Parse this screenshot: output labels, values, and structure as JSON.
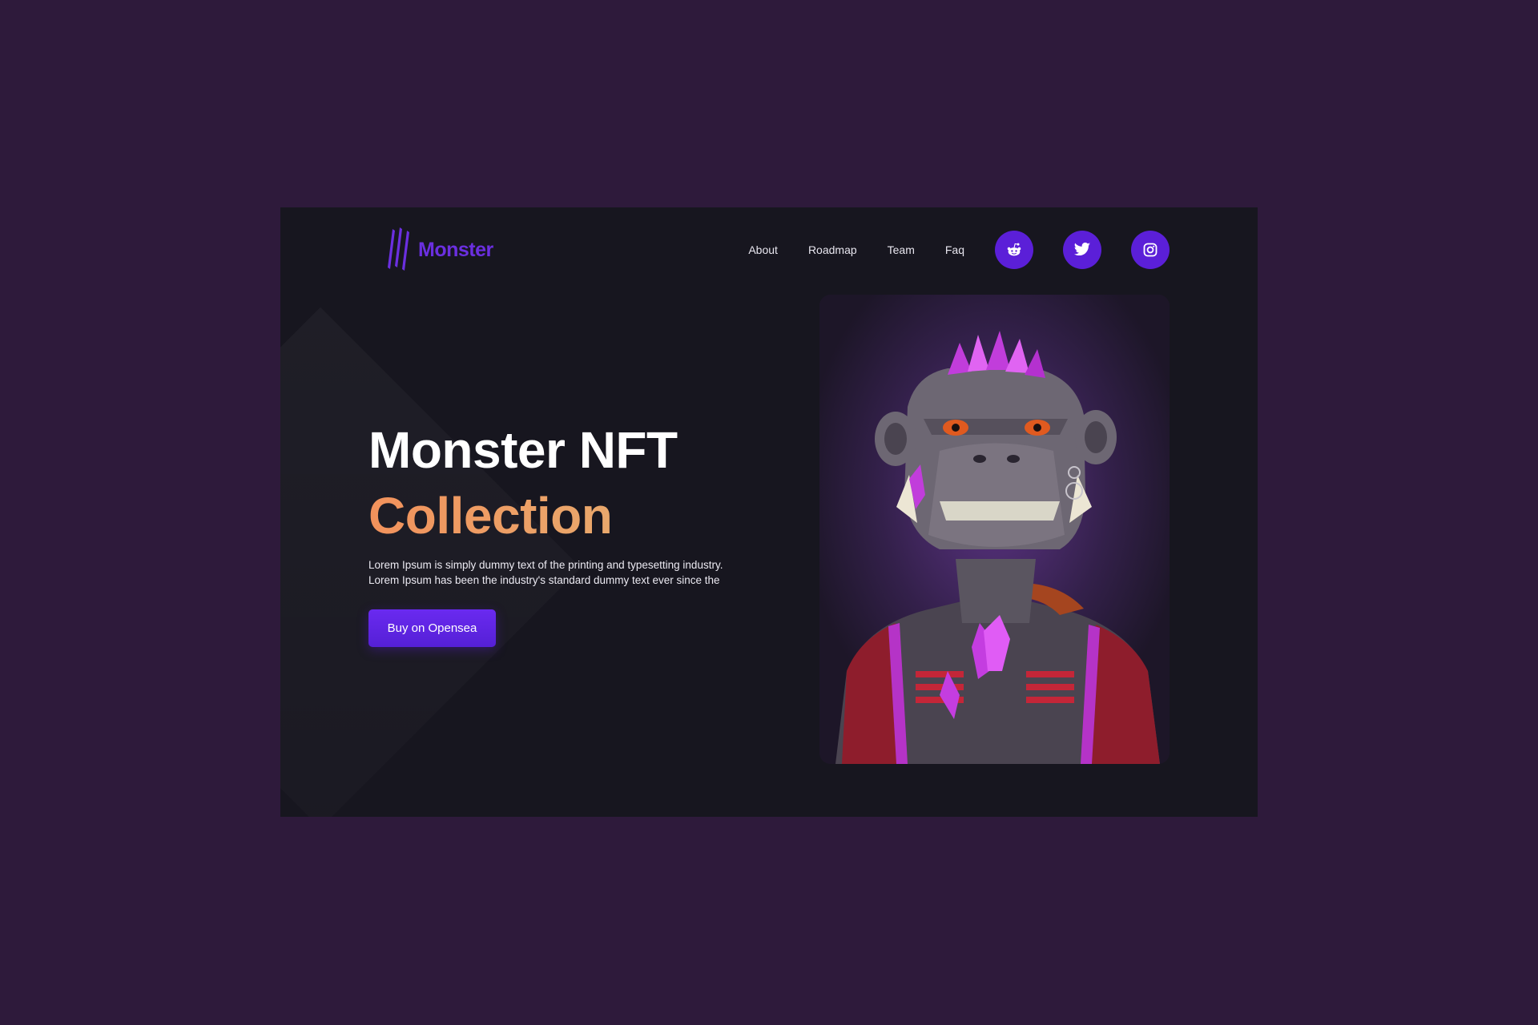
{
  "brand": {
    "name": "Monster",
    "color": "#6b2fe0"
  },
  "nav": {
    "links": [
      "About",
      "Roadmap",
      "Team",
      "Faq"
    ],
    "social": [
      {
        "icon": "reddit-icon"
      },
      {
        "icon": "twitter-icon"
      },
      {
        "icon": "instagram-icon"
      }
    ],
    "social_bg": "#5b1fd8"
  },
  "hero": {
    "title": "Monster NFT",
    "title_accent": "Collection",
    "accent_color": "#f2925c",
    "description_line1": "Lorem Ipsum is simply dummy text of the printing and typesetting industry.",
    "description_line2": "Lorem Ipsum has been the industry's standard dummy text ever since the",
    "cta_label": "Buy on Opensea"
  },
  "artwork": {
    "subject": "monster-ape-nft-illustration"
  },
  "colors": {
    "page_bg": "#2e1a3b",
    "panel_bg": "#17161f",
    "button_bg": "#5b1fd8"
  }
}
